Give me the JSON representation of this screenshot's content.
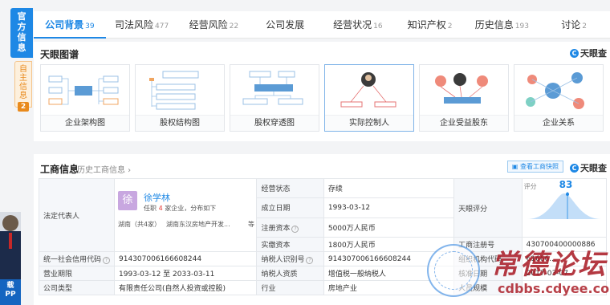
{
  "side_tabs": {
    "main": [
      "官",
      "方",
      "信",
      "息"
    ],
    "sub": [
      "自",
      "主",
      "信",
      "息"
    ],
    "sub_badge": "2"
  },
  "tabs": [
    {
      "label": "公司背景",
      "count": "39"
    },
    {
      "label": "司法风险",
      "count": "477"
    },
    {
      "label": "经营风险",
      "count": "22"
    },
    {
      "label": "公司发展",
      "count": ""
    },
    {
      "label": "经营状况",
      "count": "16"
    },
    {
      "label": "知识产权",
      "count": "2"
    },
    {
      "label": "历史信息",
      "count": "193"
    },
    {
      "label": "讨论",
      "count": "2"
    }
  ],
  "graph_section": {
    "title": "天眼图谱",
    "logo": "天眼查",
    "logo_mark": "C",
    "cards": [
      {
        "label": "企业架构图"
      },
      {
        "label": "股权结构图"
      },
      {
        "label": "股权穿透图"
      },
      {
        "label": "实际控制人"
      },
      {
        "label": "企业受益股东"
      },
      {
        "label": "企业关系"
      }
    ]
  },
  "biz_section": {
    "title": "工商信息",
    "history_link": "历史工商信息 ›",
    "snapshot_button": "查看工商快照",
    "logo": "天眼查",
    "legal_rep": {
      "key": "法定代表人",
      "avatar_char": "徐",
      "name": "徐学林",
      "desc_prefix": "任职",
      "desc_count": "4",
      "desc_suffix": "家企业，分布如下",
      "region": "湖南（共4家）",
      "company": "湖南东汉房地产开发...",
      "etc": "等"
    },
    "status": {
      "key": "经营状态",
      "value": "存续"
    },
    "founded": {
      "key": "成立日期",
      "value": "1993-03-12"
    },
    "reg_capital": {
      "key": "注册资本",
      "value": "5000万人民币"
    },
    "paid_capital": {
      "key": "实缴资本",
      "value": "1800万人民币"
    },
    "rating": {
      "key": "天眼评分",
      "label": "评分",
      "value": "83"
    },
    "reg_no": {
      "key": "工商注册号",
      "value": "430700400000886"
    },
    "credit_code": {
      "key": "统一社会信用代码",
      "value": "91430700616660824​4"
    },
    "taxpayer_id": {
      "key": "纳税人识别号",
      "value": "914307006166608244"
    },
    "org_code": {
      "key": "组织机构代码",
      "value": "61666..."
    },
    "term": {
      "key": "营业期限",
      "value": "1993-03-12  至  2033-03-11"
    },
    "taxpayer_type": {
      "key": "纳税人资质",
      "value": "增值税一般纳税人"
    },
    "approve_date": {
      "key": "核准日期",
      "value": "2017-03-07"
    },
    "company_type": {
      "key": "公司类型",
      "value": "有限责任公司(自然人投资或控股)"
    },
    "industry": {
      "key": "行业",
      "value": "房地产业"
    },
    "staff": {
      "key": "人员规模",
      "value": ""
    }
  },
  "ad": {
    "text1": "载",
    "text2": "PP"
  },
  "watermark": {
    "title": "常德论坛",
    "url": "cdbbs.cdyee.com",
    "seal": "常德论坛"
  }
}
